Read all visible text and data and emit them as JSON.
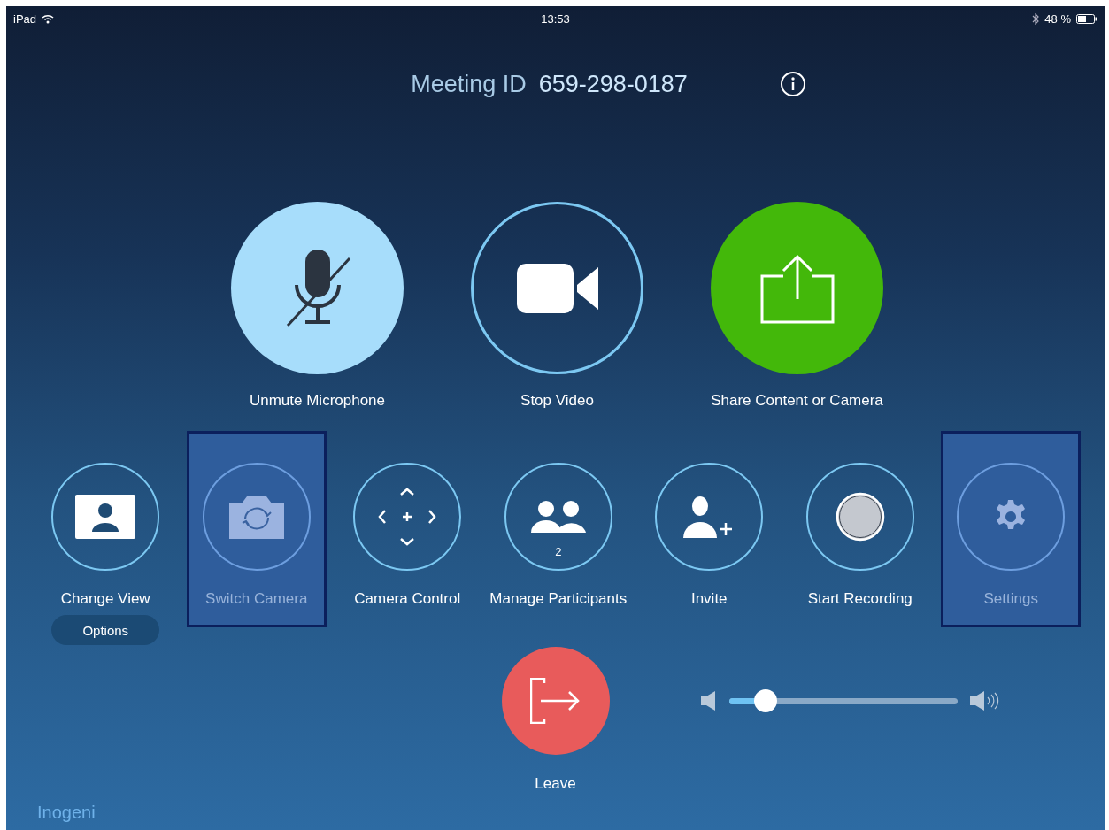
{
  "status_bar": {
    "device": "iPad",
    "time": "13:53",
    "battery": "48 %"
  },
  "meeting": {
    "label": "Meeting ID",
    "id": "659-298-0187"
  },
  "main_actions": [
    {
      "kind": "mic-muted",
      "label": "Unmute Microphone"
    },
    {
      "kind": "video",
      "label": "Stop Video"
    },
    {
      "kind": "share",
      "label": "Share Content or Camera"
    }
  ],
  "actions": [
    {
      "kind": "view",
      "label": "Change View",
      "highlighted": false,
      "sub_button": "Options"
    },
    {
      "kind": "switch-camera",
      "label": "Switch Camera",
      "highlighted": true
    },
    {
      "kind": "camera-control",
      "label": "Camera Control",
      "highlighted": false
    },
    {
      "kind": "participants",
      "label": "Manage Participants",
      "highlighted": false,
      "count": "2"
    },
    {
      "kind": "invite",
      "label": "Invite",
      "highlighted": false
    },
    {
      "kind": "record",
      "label": "Start Recording",
      "highlighted": false
    },
    {
      "kind": "settings",
      "label": "Settings",
      "highlighted": true
    }
  ],
  "leave": {
    "label": "Leave"
  },
  "volume": {
    "level": 0.16
  },
  "footer": "Inogeni"
}
